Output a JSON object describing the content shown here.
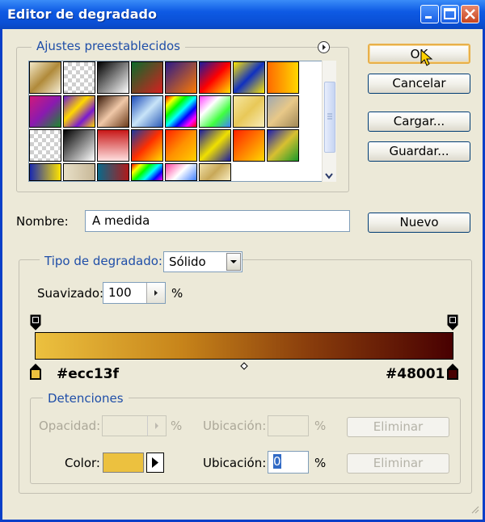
{
  "window": {
    "title": "Editor de degradado"
  },
  "presets": {
    "legend": "Ajustes preestablecidos",
    "swatches": [
      {
        "bg": "linear-gradient(135deg,#f3e8c8,#b08a3a,#f5edd5)"
      },
      {
        "bg": "checker-gold"
      },
      {
        "bg": "linear-gradient(135deg,#000,#fff)"
      },
      {
        "bg": "linear-gradient(135deg,#0a6b2a,#d81f1f)"
      },
      {
        "bg": "linear-gradient(135deg,#2b1a8a,#ff7a00)"
      },
      {
        "bg": "linear-gradient(135deg,#1a1aa0,#ff0000,#ffe400)"
      },
      {
        "bg": "linear-gradient(135deg,#ffe800,#1030c0,#ffe800)"
      },
      {
        "bg": "linear-gradient(90deg,#ff6a00,#ffd800)"
      },
      {
        "bg": "linear-gradient(135deg,#d0197a,#8a1ab0,#1a8a2a)"
      },
      {
        "bg": "linear-gradient(135deg,#6a1ad0,#ffd800 40%,#7a1ad0 70%,#ffd800)"
      },
      {
        "bg": "linear-gradient(135deg,#3a1a0a,#f0c8a8,#6a3a1a)"
      },
      {
        "bg": "linear-gradient(135deg,#1a4ab8,#c8e4f8,#2a5ab8)"
      },
      {
        "bg": "linear-gradient(135deg,#f00,#ff0,#0f0,#0ff,#00f,#f0f,#f00)"
      },
      {
        "bg": "linear-gradient(135deg,#ff40ff,#ffffff,#40ff40,#4080ff)"
      },
      {
        "bg": "linear-gradient(135deg,#f5e6a0,#e8c858,#f8ecb8)"
      },
      {
        "bg": "linear-gradient(135deg,#a0a8b0,#e8c888,#a08858)"
      },
      {
        "bg": "checker-gold2"
      },
      {
        "bg": "linear-gradient(135deg,#000,#fff)"
      },
      {
        "bg": "linear-gradient(180deg,#c81818,#ffe0e0)"
      },
      {
        "bg": "linear-gradient(135deg,#1a3aa0,#ff3000,#ffe000)"
      },
      {
        "bg": "linear-gradient(135deg,#ff2000,#ff9000,#ffd000)"
      },
      {
        "bg": "linear-gradient(135deg,#1a1aa0,#f0e000,#1a1aa0)"
      },
      {
        "bg": "linear-gradient(135deg,#ff2000,#ffd800)"
      },
      {
        "bg": "linear-gradient(135deg,#1a1ab0,#d8c030,#1a9a2a)"
      },
      {
        "bg": "linear-gradient(90deg,#1a2ab0,#ffe400)"
      },
      {
        "bg": "linear-gradient(90deg,#e8e0c8,#c8b898)"
      },
      {
        "bg": "linear-gradient(90deg,#0a6a8a,#b01a1a)"
      },
      {
        "bg": "linear-gradient(135deg,#f00,#ff0,#0f0,#0ff,#00f,#f0f)"
      },
      {
        "bg": "linear-gradient(135deg,#ff40a0,#ffffff,#4080ff)"
      },
      {
        "bg": "linear-gradient(135deg,#f0e0a8,#c8a858,#f8ecc0)"
      }
    ]
  },
  "buttons": {
    "ok": "OK",
    "cancel": "Cancelar",
    "load": "Cargar...",
    "save": "Guardar...",
    "new": "Nuevo"
  },
  "name": {
    "label": "Nombre:",
    "value": "A medida"
  },
  "gradient_type": {
    "label": "Tipo de degradado:",
    "value": "Sólido"
  },
  "smoothness": {
    "label": "Suavizado:",
    "value": "100",
    "unit": "%"
  },
  "gradient": {
    "start_color": "#ecc13f",
    "end_color": "#48001",
    "start_hex": "#ecc13f",
    "end_hex": "#480001",
    "midpoint": 0.5
  },
  "stops": {
    "legend": "Detenciones",
    "opacity_label": "Opacidad:",
    "opacity_value": "",
    "opacity_unit": "%",
    "location_label_dis": "Ubicación:",
    "location_value_dis": "",
    "location_unit_dis": "%",
    "delete_label_1": "Eliminar",
    "color_label": "Color:",
    "color_value": "#ecc13f",
    "location_label": "Ubicación:",
    "location_value": "0",
    "location_unit": "%",
    "delete_label_2": "Eliminar"
  }
}
